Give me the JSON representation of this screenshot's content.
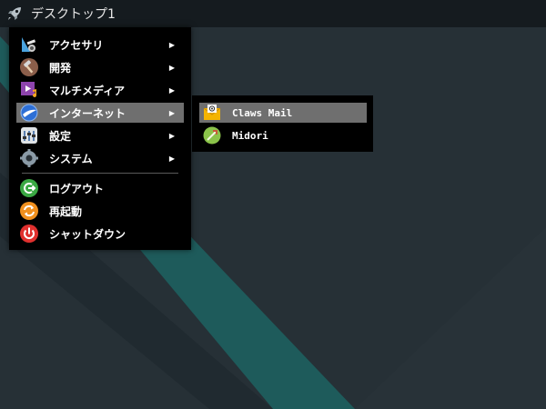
{
  "taskbar": {
    "launcher_icon": "rocket-icon",
    "title": "デスクトップ1"
  },
  "menu": {
    "items": [
      {
        "label": "アクセサリ",
        "icon": "accessories-icon",
        "submenu": true
      },
      {
        "label": "開発",
        "icon": "development-icon",
        "submenu": true
      },
      {
        "label": "マルチメディア",
        "icon": "multimedia-icon",
        "submenu": true
      },
      {
        "label": "インターネット",
        "icon": "internet-icon",
        "submenu": true,
        "active": true
      },
      {
        "label": "設定",
        "icon": "settings-icon",
        "submenu": true
      },
      {
        "label": "システム",
        "icon": "system-gear-icon",
        "submenu": true
      }
    ],
    "session": [
      {
        "label": "ログアウト",
        "icon": "logout-icon"
      },
      {
        "label": "再起動",
        "icon": "reboot-icon"
      },
      {
        "label": "シャットダウン",
        "icon": "power-icon"
      }
    ],
    "arrow": "▶"
  },
  "submenu": {
    "items": [
      {
        "label": "Claws Mail",
        "icon": "mail-icon",
        "active": true
      },
      {
        "label": "Midori",
        "icon": "midori-browser-icon"
      }
    ]
  },
  "colors": {
    "desktop": "#263036",
    "stripe": "#1f5a5a",
    "menu_bg": "#000000",
    "highlight": "#6f6f6f"
  }
}
